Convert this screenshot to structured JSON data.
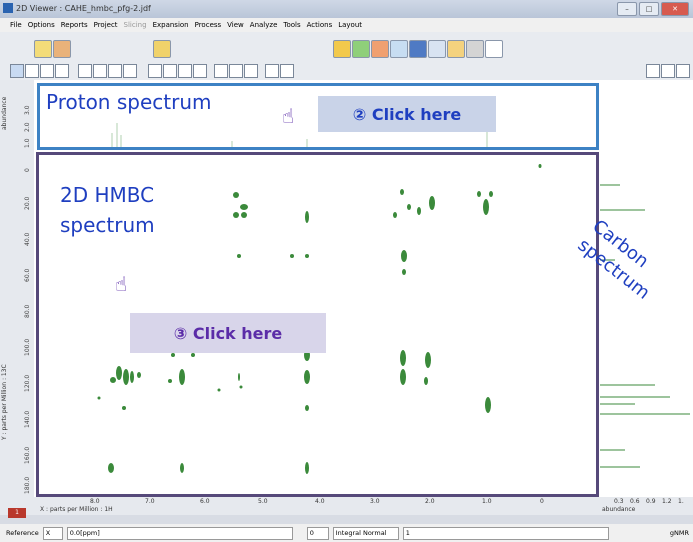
{
  "window": {
    "title": "2D Viewer : CAHE_hmbc_pfg-2.jdf"
  },
  "menu": {
    "items": [
      "File",
      "Options",
      "Reports",
      "Project",
      "Slicing",
      "Expansion",
      "Process",
      "View",
      "Analyze",
      "Tools",
      "Actions",
      "Layout"
    ],
    "disabled": [
      "Slicing"
    ]
  },
  "annotations": {
    "proton_label": "Proton spectrum",
    "hmbc_label_line1": "2D HMBC",
    "hmbc_label_line2": "spectrum",
    "carbon_label_line1": "Carbon",
    "carbon_label_line2": "spectrum",
    "click2": "② Click here",
    "click3": "③ Click here"
  },
  "axes": {
    "y_axis_label": "Y : parts per Million : 13C",
    "abundance_label": "abundance",
    "x_axis_label": "X : parts per Million : 1H",
    "x_ticks": [
      "8.0",
      "7.0",
      "6.0",
      "5.0",
      "4.0",
      "3.0",
      "2.0",
      "1.0",
      "0"
    ],
    "y_ticks": [
      "0",
      "20.0",
      "40.0",
      "60.0",
      "80.0",
      "100.0",
      "120.0",
      "140.0",
      "160.0",
      "180.0"
    ],
    "proton_y_ticks": [
      "3.0",
      "2.0",
      "1.0"
    ],
    "carbon_ticks": [
      "0.3",
      "0.6",
      "0.9",
      "1.2",
      "1."
    ],
    "carbon_axis_label": "abundance"
  },
  "statusbar": {
    "reference_label": "Reference",
    "reference_axis": "X",
    "ppm_value": "0.0[ppm]",
    "integral_mode": "Integral Normal",
    "count_value": "1",
    "app_name": "gNMR"
  },
  "colors": {
    "accent_blue": "#3d82c4",
    "hmbc_border": "#56497a",
    "peak_green": "#3b8a3b"
  }
}
